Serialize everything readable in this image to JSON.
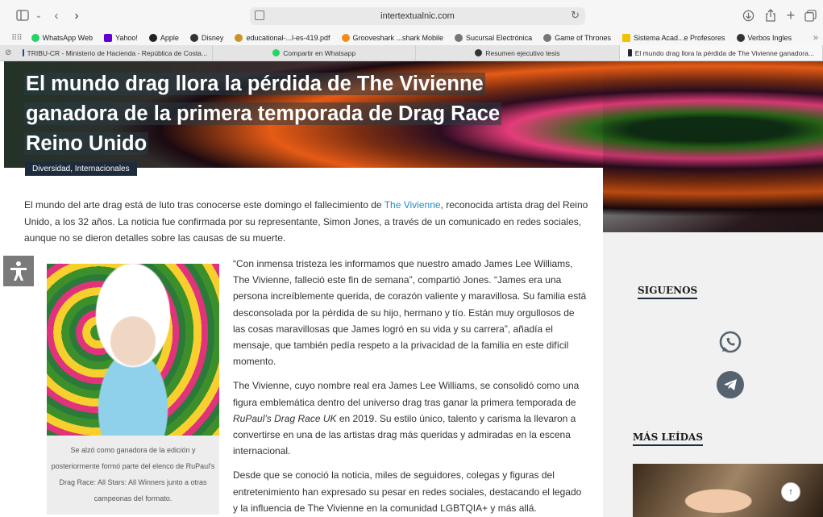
{
  "browser": {
    "url": "intertextualnic.com",
    "favorites": [
      {
        "label": "WhatsApp Web",
        "color": "#25d366"
      },
      {
        "label": "Yahoo!",
        "color": "#6001d2"
      },
      {
        "label": "Apple",
        "color": "#222222"
      },
      {
        "label": "Disney",
        "color": "#333333"
      },
      {
        "label": "educational-...l-es-419.pdf",
        "color": "#c9932b"
      },
      {
        "label": "Grooveshark ...shark Mobile",
        "color": "#f08c1c"
      },
      {
        "label": "Sucursal Electrónica",
        "color": "#777777"
      },
      {
        "label": "Game of Thrones",
        "color": "#777777"
      },
      {
        "label": "Sistema Acad...e Profesores",
        "color": "#f2c200"
      },
      {
        "label": "Verbos Ingles",
        "color": "#333333"
      }
    ],
    "tabs": [
      {
        "label": "TRIBU-CR - Ministerio de Hacienda - República de Costa...",
        "color": "#1c4e8c"
      },
      {
        "label": "Compartir en Whatsapp",
        "color": "#25d366"
      },
      {
        "label": "Resumen ejecutivo tesis",
        "color": "#333333"
      },
      {
        "label": "El mundo drag llora la pérdida de The Vivienne ganadora...",
        "color": "#1e2b3c"
      }
    ]
  },
  "article": {
    "title_lines": [
      "El mundo drag llora la pérdida de The Vivienne",
      "ganadora de la primera temporada de Drag Race",
      "Reino Unido"
    ],
    "category": "Diversidad, Internacionales",
    "intro_before_link": "El mundo del arte drag está de luto tras conocerse este domingo el fallecimiento de ",
    "intro_link": "The Vivienne",
    "intro_after_link": ", reconocida artista drag del Reino Unido, a los 32 años. La noticia fue confirmada por su representante, Simon Jones, a través de un comunicado en redes sociales, aunque no se dieron detalles sobre las causas de su muerte.",
    "caption": "Se alzó como ganadora de la edición y posteriormente formó parte del elenco de RuPaul's Drag Race: All Stars: All Winners junto a otras campeonas del formato.",
    "para1": "“Con inmensa tristeza les informamos que nuestro amado James Lee Williams, The Vivienne, falleció este fin de semana”, compartió Jones. “James era una persona increíblemente querida, de corazón valiente y maravillosa. Su familia está desconsolada por la pérdida de su hijo, hermano y tío. Están muy orgullosos de las cosas maravillosas que James logró en su vida y su carrera”, añadía el mensaje, que también pedía respeto a la privacidad de la familia en este difícil momento.",
    "para2_before": "The Vivienne, cuyo nombre real era James Lee Williams, se consolidó como una figura emblemática dentro del universo drag tras ganar la primera temporada de ",
    "para2_italic": "RuPaul’s Drag Race UK",
    "para2_after": " en 2019. Su estilo único, talento y carisma la llevaron a convertirse en una de las artistas drag más queridas y admiradas en la escena internacional.",
    "para3": "Desde que se conoció la noticia, miles de seguidores, colegas y figuras del entretenimiento han expresado su pesar en redes sociales, destacando el legado y la influencia de The Vivienne en la comunidad LGBTQIA+ y más allá."
  },
  "sidebar": {
    "follow_title": "SIGUENOS",
    "most_read_title": "MÁS LEÍDAS"
  },
  "colors": {
    "accent": "#1e2b3c",
    "link": "#1e8ec7"
  }
}
